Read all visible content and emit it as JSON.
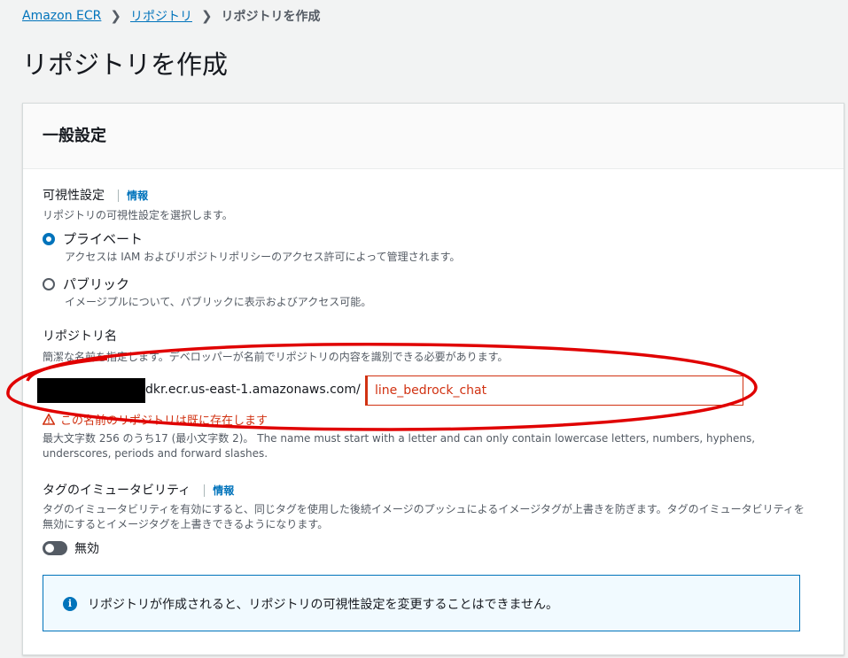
{
  "breadcrumb": {
    "items": [
      "Amazon ECR",
      "リポジトリ",
      "リポジトリを作成"
    ]
  },
  "page": {
    "title": "リポジトリを作成"
  },
  "general_settings": {
    "title": "一般設定",
    "visibility": {
      "label": "可視性設定",
      "info": "情報",
      "description": "リポジトリの可視性設定を選択します。",
      "options": [
        {
          "label": "プライベート",
          "description": "アクセスは IAM およびリポジトリポリシーのアクセス許可によって管理されます。",
          "selected": true
        },
        {
          "label": "パブリック",
          "description": "イメージプルについて、パブリックに表示およびアクセス可能。",
          "selected": false
        }
      ]
    },
    "repo_name": {
      "label": "リポジトリ名",
      "description": "簡潔な名前を指定します。デベロッパーが名前でリポジトリの内容を識別できる必要があります。",
      "uri_suffix": "dkr.ecr.us-east-1.amazonaws.com/",
      "value": "line_bedrock_chat",
      "error": "この名前のリポジトリは既に存在します",
      "constraint": "最大文字数 256 のうち17 (最小文字数 2)。 The name must start with a letter and can only contain lowercase letters, numbers, hyphens, underscores, periods and forward slashes."
    },
    "tag_immutability": {
      "label": "タグのイミュータビリティ",
      "info": "情報",
      "description": "タグのイミュータビリティを有効にすると、同じタグを使用した後続イメージのプッシュによるイメージタグが上書きを防ぎます。タグのイミュータビリティを無効にするとイメージタグを上書きできるようになります。",
      "toggle_label": "無効",
      "enabled": false
    },
    "alert": {
      "icon": "info-icon",
      "text": "リポジトリが作成されると、リポジトリの可視性設定を変更することはできません。"
    }
  },
  "colors": {
    "link": "#0073bb",
    "error": "#d13212",
    "annotation": "#e00000"
  }
}
